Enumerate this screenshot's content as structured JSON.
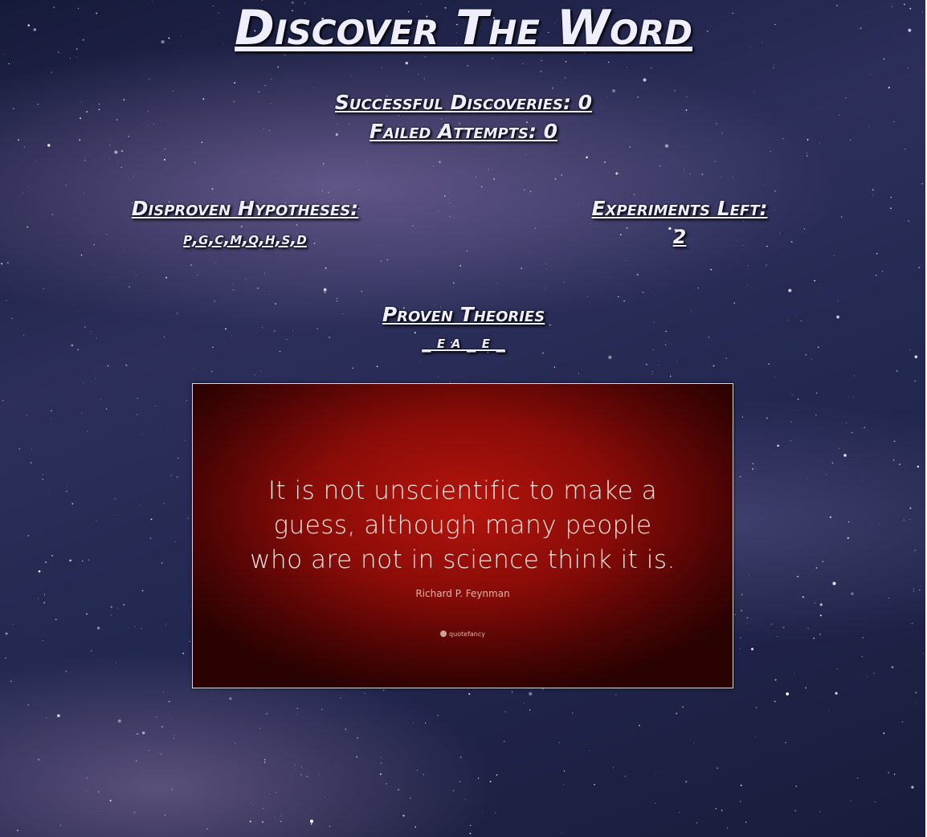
{
  "game": {
    "title": "Discover The Word",
    "successful_discoveries": "Successful Discoveries: 0",
    "failed_attempts": "Failed Attempts: 0",
    "disproven_label": "Disproven Hypotheses:",
    "disproven_letters": "p,g,c,m,q,h,s,d",
    "experiments_label": "Experiments Left:",
    "experiments_left": "2",
    "proven_label": "Proven Theories",
    "proven_word": "_ e a _ e _"
  },
  "quote_card": {
    "lines": [
      "It is not unscientific to make a",
      "guess, although many people",
      "who are not in science think it is."
    ],
    "author": "Richard P. Feynman",
    "brand": "quotefancy"
  },
  "colors": {
    "text": "#eeeeff",
    "card_red": "#b4140c",
    "background": "#232850"
  }
}
